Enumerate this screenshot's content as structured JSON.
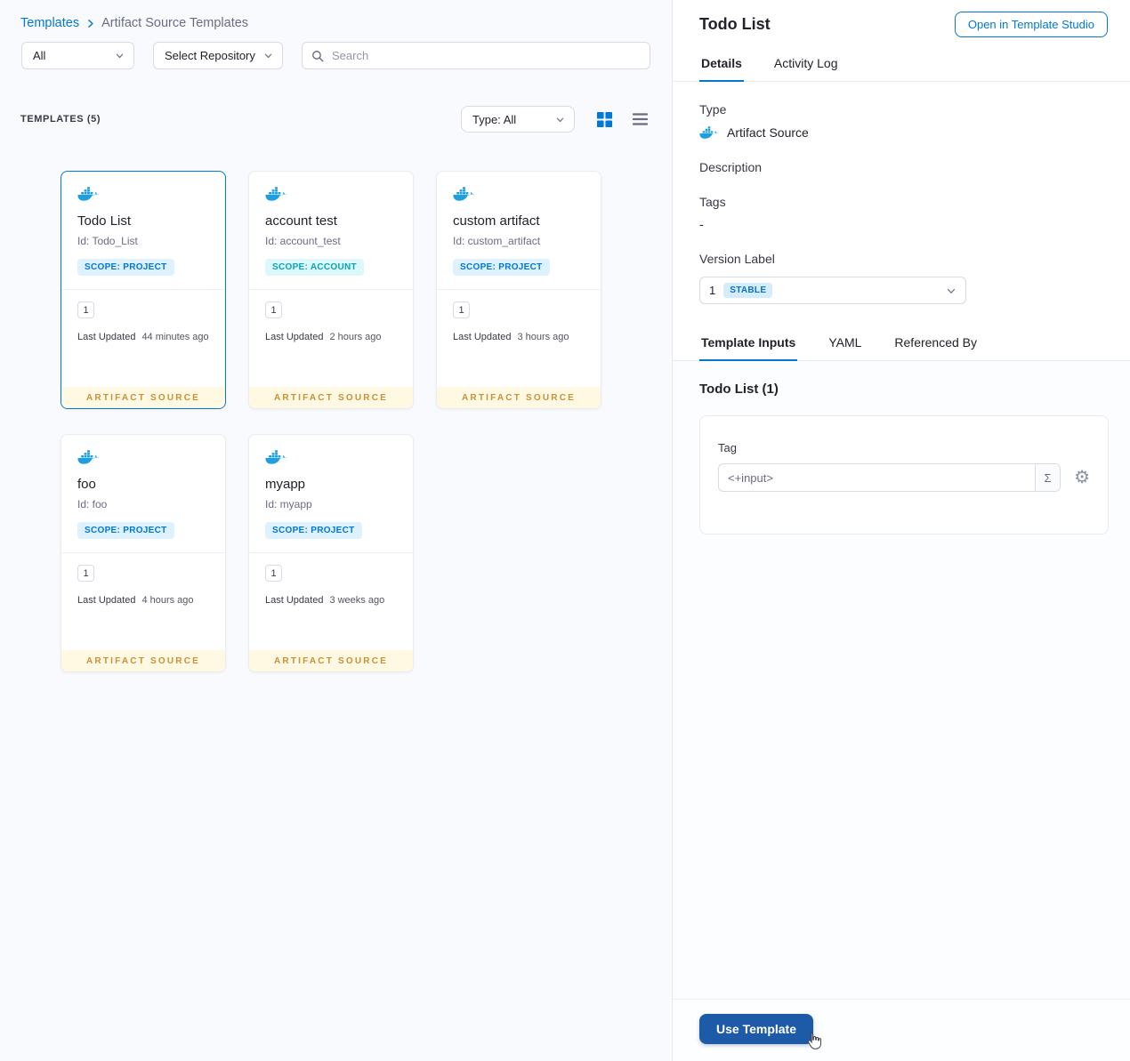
{
  "colors": {
    "accent": "#0278d5",
    "selected_card_border": "#0278d5",
    "scope_project_bg": "#ddf1ff",
    "scope_project_text": "#0278d5",
    "scope_account_bg": "#dcf8fb",
    "scope_account_text": "#0aa3b7",
    "artifact_source_bg": "#fff8e3",
    "artifact_source_text": "#ca9136",
    "stable_badge_bg": "#d4edfd",
    "stable_badge_text": "#0b72c8",
    "use_template_button_bg": "#1d5aa8"
  },
  "breadcrumb": {
    "templates": "Templates",
    "current": "Artifact Source Templates"
  },
  "filters": {
    "scope": "All",
    "repository": "Select Repository",
    "search_placeholder": "Search"
  },
  "list_header": {
    "count_label": "TEMPLATES (5)",
    "type_filter": "Type: All"
  },
  "cards": [
    {
      "name": "Todo List",
      "id": "Id: Todo_List",
      "scope": "SCOPE: PROJECT",
      "scope_type": "project",
      "version": "1",
      "last_updated_label": "Last Updated",
      "last_updated": "44 minutes ago",
      "footer": "ARTIFACT SOURCE",
      "selected": true
    },
    {
      "name": "account test",
      "id": "Id: account_test",
      "scope": "SCOPE: ACCOUNT",
      "scope_type": "account",
      "version": "1",
      "last_updated_label": "Last Updated",
      "last_updated": "2 hours ago",
      "footer": "ARTIFACT SOURCE",
      "selected": false
    },
    {
      "name": "custom artifact",
      "id": "Id: custom_artifact",
      "scope": "SCOPE: PROJECT",
      "scope_type": "project",
      "version": "1",
      "last_updated_label": "Last Updated",
      "last_updated": "3 hours ago",
      "footer": "ARTIFACT SOURCE",
      "selected": false
    },
    {
      "name": "foo",
      "id": "Id: foo",
      "scope": "SCOPE: PROJECT",
      "scope_type": "project",
      "version": "1",
      "last_updated_label": "Last Updated",
      "last_updated": "4 hours ago",
      "footer": "ARTIFACT SOURCE",
      "selected": false
    },
    {
      "name": "myapp",
      "id": "Id: myapp",
      "scope": "SCOPE: PROJECT",
      "scope_type": "project",
      "version": "1",
      "last_updated_label": "Last Updated",
      "last_updated": "3 weeks ago",
      "footer": "ARTIFACT SOURCE",
      "selected": false
    }
  ],
  "panel": {
    "title": "Todo List",
    "open_in_studio": "Open in Template Studio",
    "tabs": {
      "details": "Details",
      "activity_log": "Activity Log"
    },
    "details": {
      "type_label": "Type",
      "type_value": "Artifact Source",
      "description_label": "Description",
      "tags_label": "Tags",
      "tags_value": "-",
      "version_label": "Version Label",
      "version_value": "1",
      "version_badge": "STABLE"
    },
    "inner_tabs": {
      "template_inputs": "Template Inputs",
      "yaml": "YAML",
      "referenced_by": "Referenced By"
    },
    "inputs": {
      "section_title": "Todo List (1)",
      "tag_label": "Tag",
      "tag_value": "<+input>",
      "sigma": "Σ"
    },
    "use_template": "Use Template"
  }
}
